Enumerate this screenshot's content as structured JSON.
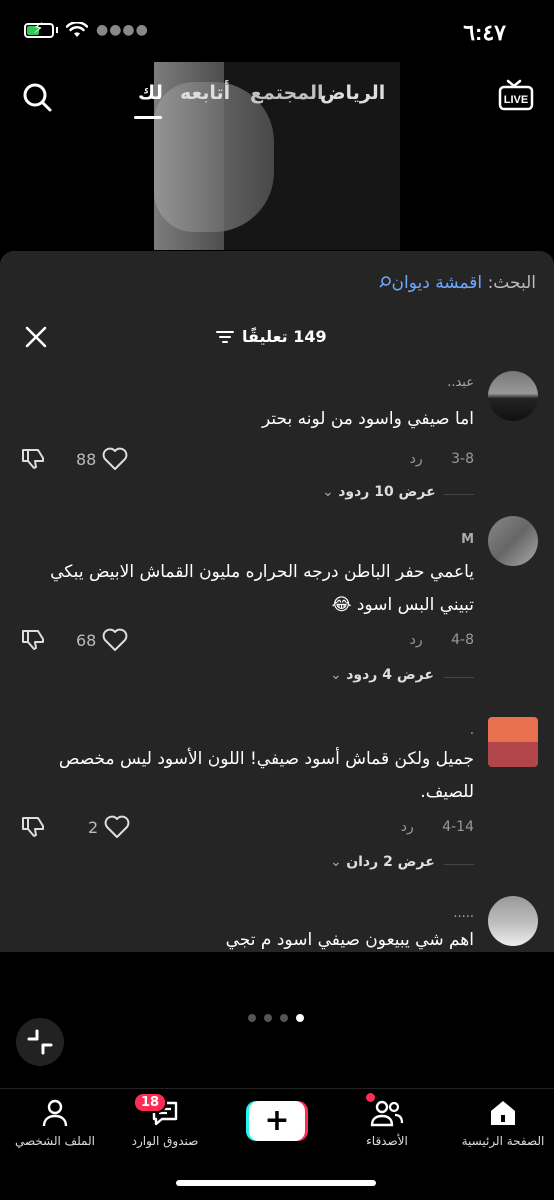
{
  "status_bar": {
    "time": "٦:٤٧"
  },
  "top_nav": {
    "tabs": [
      "لك",
      "أتابعه",
      "المجتمع",
      "الرياض"
    ],
    "live_label": "LIVE"
  },
  "comments_sheet": {
    "search_label": "البحث:",
    "search_term": "اقمشة ديوان",
    "count_label": "149 تعليقًا",
    "comments": [
      {
        "username": "عبد..",
        "text": "اما صيفي واسود من لونه بحتر",
        "date": "3-8",
        "reply_label": "رد",
        "likes": "88",
        "view_replies": "عرض 10 ردود"
      },
      {
        "username": "M",
        "text": "ياعمي حفر الباطن درجه الحراره مليون القماش الابيض يبكي تبيني البس اسود 😂",
        "date": "4-8",
        "reply_label": "رد",
        "likes": "68",
        "view_replies": "عرض 4 ردود"
      },
      {
        "username": ".",
        "text": "جميل ولكن قماش أسود صيفي! اللون الأسود ليس مخصص للصيف.",
        "date": "4-14",
        "reply_label": "رد",
        "likes": "2",
        "view_replies": "عرض 2 ردان"
      },
      {
        "username": ".....",
        "text": "اهم شي يبيعون صيفي اسود م تجي",
        "date": "",
        "reply_label": "",
        "likes": "",
        "view_replies": ""
      }
    ]
  },
  "bottom_nav": {
    "home": "الصفحة الرئيسية",
    "friends": "الأصدقاء",
    "inbox": "صندوق الوارد",
    "inbox_badge": "18",
    "profile": "الملف الشخصي"
  },
  "colors": {
    "accent": "#fe2c55",
    "cyan": "#25f4ee",
    "search_term": "#6ea8ff"
  }
}
